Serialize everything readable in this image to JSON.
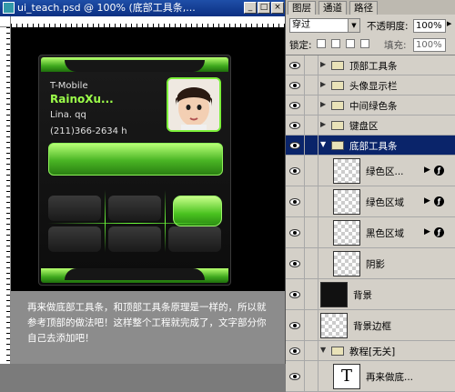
{
  "document": {
    "title": "ui_teach.psd @ 100% (底部工具条,...",
    "caption": "再来做底部工具条，和顶部工具条原理是一样的，所以就参考顶部的做法吧！这样整个工程就完成了，文字部分你自己去添加吧！"
  },
  "phone": {
    "carrier": "T-Mobile",
    "name": "RainoXu...",
    "qq": "Lina. qq",
    "phone_number": "(211)366-2634 h"
  },
  "panel": {
    "tabs": [
      "图层",
      "通道",
      "路径"
    ],
    "blend_mode": "穿过",
    "opacity_label": "不透明度:",
    "opacity_value": "100%",
    "lock_label": "锁定:",
    "fill_label": "填充:",
    "fill_value": "100%"
  },
  "layers": [
    {
      "name": "顶部工具条",
      "kind": "group"
    },
    {
      "name": "头像显示栏",
      "kind": "group"
    },
    {
      "name": "中间绿色条",
      "kind": "group"
    },
    {
      "name": "键盘区",
      "kind": "group"
    },
    {
      "name": "底部工具条",
      "kind": "group-open",
      "selected": true
    },
    {
      "name": "绿色区...",
      "kind": "layer-fx"
    },
    {
      "name": "绿色区域",
      "kind": "layer-fx"
    },
    {
      "name": "黑色区域",
      "kind": "layer-fx"
    },
    {
      "name": "阴影",
      "kind": "layer"
    },
    {
      "name": "背景",
      "kind": "layer-black"
    },
    {
      "name": "背景边框",
      "kind": "layer"
    },
    {
      "name": "教程[无关]",
      "kind": "group-open"
    },
    {
      "name": "再来做底...",
      "kind": "text"
    }
  ],
  "colors": {
    "accent_green": "#7cf03a",
    "selection": "#0a246a"
  }
}
